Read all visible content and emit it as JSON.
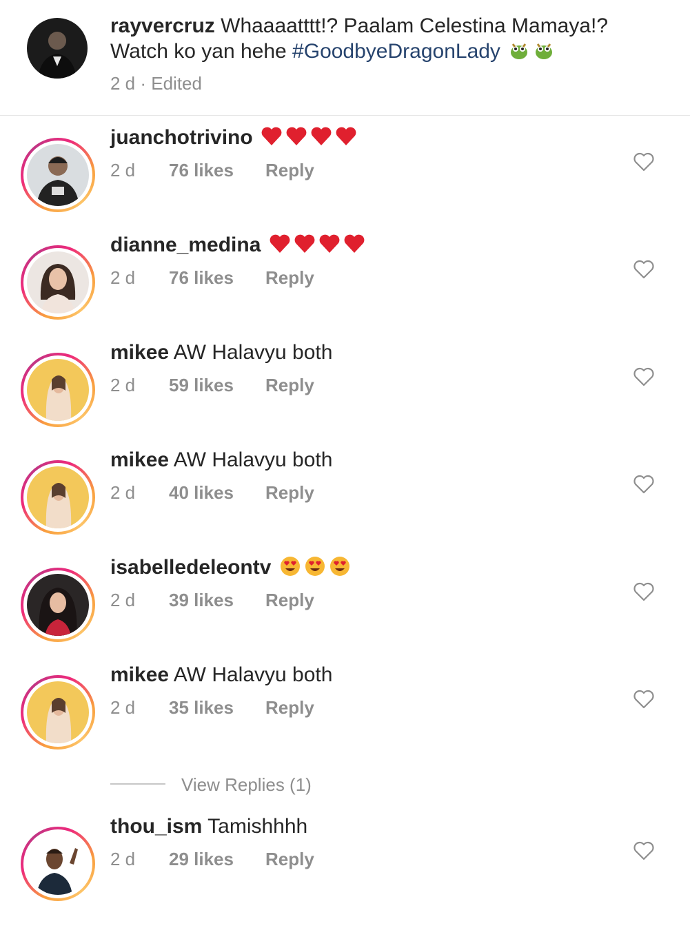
{
  "caption": {
    "username": "rayvercruz",
    "text_line1": "Whaaaatttt!? Paalam Celestina Mamaya!?",
    "text_line2": "Watch ko yan hehe",
    "hashtag": "#GoodbyeDragonLady",
    "emoji": [
      "dragon",
      "dragon"
    ],
    "meta": "2 d · Edited"
  },
  "comments": [
    {
      "username": "juanchotrivino",
      "text": "",
      "emoji": [
        "heart",
        "heart",
        "heart",
        "heart"
      ],
      "time": "2 d",
      "likes": "76 likes",
      "reply": "Reply"
    },
    {
      "username": "dianne_medina",
      "text": "",
      "emoji": [
        "heart",
        "heart",
        "heart",
        "heart"
      ],
      "time": "2 d",
      "likes": "76 likes",
      "reply": "Reply"
    },
    {
      "username": "mikee",
      "text": "AW Halavyu both",
      "emoji": [],
      "time": "2 d",
      "likes": "59 likes",
      "reply": "Reply"
    },
    {
      "username": "mikee",
      "text": "AW Halavyu both",
      "emoji": [],
      "time": "2 d",
      "likes": "40 likes",
      "reply": "Reply"
    },
    {
      "username": "isabelledeleontv",
      "text": "",
      "emoji": [
        "heart-eyes",
        "heart-eyes",
        "heart-eyes"
      ],
      "time": "2 d",
      "likes": "39 likes",
      "reply": "Reply"
    },
    {
      "username": "mikee",
      "text": "AW Halavyu both",
      "emoji": [],
      "time": "2 d",
      "likes": "35 likes",
      "reply": "Reply"
    },
    {
      "username": "thou_ism",
      "text": "Tamishhhh",
      "emoji": [],
      "time": "2 d",
      "likes": "29 likes",
      "reply": "Reply"
    }
  ],
  "view_replies": "View Replies (1)",
  "colors": {
    "text": "#262626",
    "secondary": "#8e8e8e",
    "hashtag": "#27446e",
    "ring_gradient": [
      "#f9a03f",
      "#ee2a7b",
      "#c13584"
    ]
  },
  "icons": {
    "like": "heart-outline-icon"
  }
}
